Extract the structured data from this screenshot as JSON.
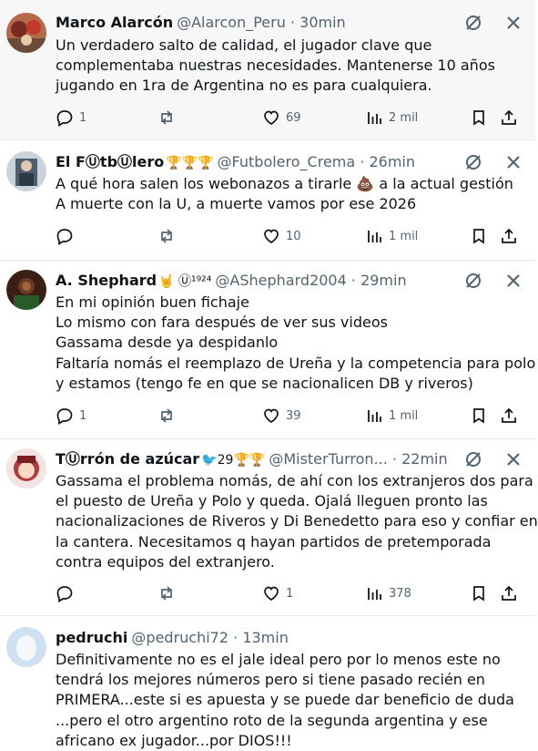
{
  "posts": [
    {
      "name": "Marco Alarcón",
      "badges": "",
      "handle": "@Alarcon_Peru",
      "dot": "·",
      "time": "30min",
      "lines": [
        "Un verdadero salto de calidad, el jugador clave que",
        "complementaba nuestras necesidades. Mantenerse 10 años",
        "jugando en 1ra de Argentina no es para cualquiera."
      ],
      "replies": "1",
      "retweets": "",
      "likes": "69",
      "views": "2 mil",
      "avatar_color": "#8a3b2b"
    },
    {
      "name": "El FⓊtbⓊlero",
      "badges": "🏆🏆🏆",
      "handle": "@Futbolero_Crema",
      "dot": "·",
      "time": "26min",
      "lines": [
        "A qué hora salen los webonazos a tirarle 💩 a la actual gestión",
        "A muerte con la U, a muerte vamos por ese 2026"
      ],
      "replies": "",
      "retweets": "",
      "likes": "10",
      "views": "1 mil",
      "avatar_color": "#6d7d8c"
    },
    {
      "name": "A. Shephard",
      "badges": "🤘 Ⓤ¹⁹²⁴",
      "handle": "@AShephard2004",
      "dot": "·",
      "time": "29min",
      "lines": [
        "En mi opinión buen fichaje",
        "Lo mismo con fara después de ver sus videos",
        "Gassama desde ya despidanlo",
        "Faltaría nomás el reemplazo de Ureña y la competencia para polo",
        "y estamos (tengo fe en que se nacionalicen DB y riveros)"
      ],
      "replies": "1",
      "retweets": "",
      "likes": "39",
      "views": "1 mil",
      "avatar_color": "#4a2a1e"
    },
    {
      "name": "TⓊrrón de azúcar",
      "badges": "🐦29🏆🏆",
      "handle": "@MisterTurron...",
      "dot": "·",
      "time": "22min",
      "lines": [
        "Gassama el problema nomás, de ahí con los extranjeros dos para",
        "el puesto de Ureña y Polo y queda. Ojalá lleguen pronto las",
        "nacionalizaciones de Riveros y Di Benedetto para eso y confiar en",
        "la cantera. Necesitamos q hayan partidos de pretemporada",
        "contra equipos del extranjero."
      ],
      "replies": "",
      "retweets": "",
      "likes": "1",
      "views": "378",
      "avatar_color": "#c94a4a"
    },
    {
      "name": "pedruchi",
      "badges": "",
      "handle": "@pedruchi72",
      "dot": "·",
      "time": "13min",
      "lines": [
        "Definitivamente no es el jale ideal pero por lo menos este no",
        "tendrá los mejores números pero si tiene pasado recién en",
        "PRIMERA...este si es  apuesta y se puede dar beneficio de duda",
        "...pero el otro argentino roto de la segunda argentina y ese",
        "africano ex jugador...por DIOS!!!"
      ],
      "replies": "",
      "retweets": "",
      "likes": "",
      "views": "",
      "avatar_color": "#dfe9f5"
    }
  ],
  "colors": {
    "text": "#0f1419",
    "muted": "#536471",
    "divider": "#e6e9eb",
    "highlight_bg": "#f7f7f7"
  }
}
